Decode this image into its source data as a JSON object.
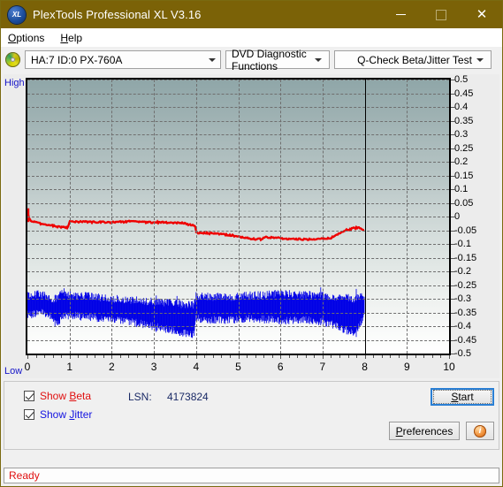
{
  "window": {
    "title": "PlexTools Professional XL V3.16",
    "icon": "xl-app-icon",
    "minimize_label": "—",
    "maximize_label": "□",
    "close_label": "✕"
  },
  "menu": {
    "items": [
      {
        "label": "Options",
        "accel": "O"
      },
      {
        "label": "Help",
        "accel": "H"
      }
    ]
  },
  "toolbar": {
    "drive_icon": "optical-disc-icon",
    "drive_select": "HA:7 ID:0  PX-760A",
    "function_select": "DVD Diagnostic Functions",
    "test_select": "Q-Check Beta/Jitter Test"
  },
  "chart_labels": {
    "high": "High",
    "low": "Low"
  },
  "controls": {
    "show_beta_label": "Show Beta",
    "show_beta_accel": "B",
    "show_beta_checked": true,
    "show_jitter_label": "Show Jitter",
    "show_jitter_accel": "J",
    "show_jitter_checked": true,
    "lsn_label": "LSN:",
    "lsn_value": "4173824",
    "start_label": "Start",
    "start_accel": "S",
    "preferences_label": "Preferences",
    "preferences_accel": "P",
    "info_label": "i"
  },
  "statusbar": {
    "text": "Ready"
  },
  "colors": {
    "titlebar": "#7b6207",
    "beta_line": "#ee0000",
    "jitter_band": "#0000e6",
    "axis_label": "#1414c8",
    "status_text": "#e01010",
    "focus_border": "#2a7fd4"
  },
  "chart_data": {
    "type": "line",
    "title": "Q-Check Beta/Jitter Test",
    "xlabel": "",
    "ylabel": "",
    "xlim": [
      0,
      10
    ],
    "ylim": [
      -0.5,
      0.5
    ],
    "grid": true,
    "legend": "none",
    "xticks": [
      0,
      1,
      2,
      3,
      4,
      5,
      6,
      7,
      8,
      9,
      10
    ],
    "yticks": [
      0.5,
      0.45,
      0.4,
      0.35,
      0.3,
      0.25,
      0.2,
      0.15,
      0.1,
      0.05,
      0,
      -0.05,
      -0.1,
      -0.15,
      -0.2,
      -0.25,
      -0.3,
      -0.35,
      -0.4,
      -0.45,
      -0.5
    ],
    "cursor_x": 8.0,
    "data_end_x": 8.0,
    "series": [
      {
        "name": "Beta",
        "color": "#ee0000",
        "type": "line",
        "x": [
          0.0,
          0.05,
          0.1,
          0.2,
          0.3,
          0.45,
          0.6,
          0.75,
          0.85,
          0.95,
          1.0,
          1.05,
          1.2,
          1.5,
          1.8,
          2.1,
          2.4,
          2.55,
          2.7,
          2.9,
          3.1,
          3.3,
          3.5,
          3.7,
          3.85,
          3.95,
          3.98,
          4.0,
          4.05,
          4.2,
          4.4,
          4.6,
          4.8,
          5.0,
          5.2,
          5.4,
          5.55,
          5.6,
          5.8,
          6.0,
          6.2,
          6.4,
          6.6,
          6.8,
          6.9,
          7.0,
          7.2,
          7.4,
          7.55,
          7.7,
          7.85,
          7.95,
          8.0
        ],
        "y": [
          0.015,
          -0.01,
          -0.018,
          -0.022,
          -0.026,
          -0.03,
          -0.033,
          -0.038,
          -0.04,
          -0.04,
          -0.02,
          -0.019,
          -0.019,
          -0.02,
          -0.021,
          -0.021,
          -0.018,
          -0.018,
          -0.02,
          -0.021,
          -0.021,
          -0.022,
          -0.022,
          -0.023,
          -0.03,
          -0.031,
          -0.031,
          -0.06,
          -0.061,
          -0.06,
          -0.062,
          -0.064,
          -0.068,
          -0.072,
          -0.078,
          -0.082,
          -0.083,
          -0.075,
          -0.076,
          -0.079,
          -0.082,
          -0.083,
          -0.083,
          -0.082,
          -0.08,
          -0.08,
          -0.079,
          -0.06,
          -0.05,
          -0.044,
          -0.04,
          -0.05,
          -0.046
        ]
      },
      {
        "name": "Jitter",
        "color": "#0000e6",
        "type": "band",
        "x": [
          0.0,
          0.1,
          0.25,
          0.4,
          0.55,
          0.7,
          0.8,
          0.9,
          1.0,
          1.15,
          1.3,
          1.5,
          1.7,
          1.9,
          2.1,
          2.3,
          2.5,
          2.7,
          2.9,
          3.1,
          3.3,
          3.5,
          3.7,
          3.85,
          3.95,
          4.0,
          4.1,
          4.3,
          4.5,
          4.7,
          4.9,
          5.1,
          5.3,
          5.5,
          5.7,
          5.9,
          6.1,
          6.3,
          6.5,
          6.7,
          6.9,
          7.1,
          7.3,
          7.5,
          7.65,
          7.8,
          7.9,
          8.0
        ],
        "y_upper": [
          -0.29,
          -0.292,
          -0.28,
          -0.288,
          -0.3,
          -0.3,
          -0.278,
          -0.276,
          -0.285,
          -0.292,
          -0.288,
          -0.292,
          -0.295,
          -0.298,
          -0.3,
          -0.302,
          -0.304,
          -0.306,
          -0.31,
          -0.312,
          -0.315,
          -0.318,
          -0.32,
          -0.322,
          -0.324,
          -0.288,
          -0.29,
          -0.292,
          -0.293,
          -0.294,
          -0.292,
          -0.29,
          -0.288,
          -0.286,
          -0.284,
          -0.282,
          -0.28,
          -0.282,
          -0.284,
          -0.286,
          -0.288,
          -0.29,
          -0.292,
          -0.294,
          -0.298,
          -0.3,
          -0.292,
          -0.288
        ],
        "y_lower": [
          -0.355,
          -0.358,
          -0.352,
          -0.35,
          -0.362,
          -0.4,
          -0.375,
          -0.362,
          -0.36,
          -0.362,
          -0.366,
          -0.368,
          -0.372,
          -0.374,
          -0.378,
          -0.382,
          -0.386,
          -0.392,
          -0.398,
          -0.404,
          -0.41,
          -0.418,
          -0.424,
          -0.43,
          -0.432,
          -0.372,
          -0.374,
          -0.376,
          -0.378,
          -0.378,
          -0.376,
          -0.374,
          -0.372,
          -0.374,
          -0.376,
          -0.378,
          -0.38,
          -0.378,
          -0.376,
          -0.378,
          -0.382,
          -0.388,
          -0.396,
          -0.41,
          -0.424,
          -0.418,
          -0.386,
          -0.36
        ]
      }
    ]
  }
}
